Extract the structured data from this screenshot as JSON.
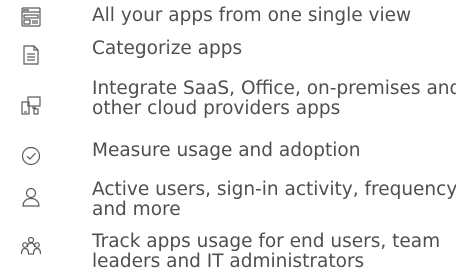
{
  "features": [
    {
      "icon": "app-view-icon",
      "lines": [
        "All your apps from one single view"
      ]
    },
    {
      "icon": "document-icon",
      "lines": [
        "Categorize apps"
      ]
    },
    {
      "icon": "devices-icon",
      "lines": [
        "Integrate SaaS, Office, on-premises and",
        "other cloud providers apps"
      ]
    },
    {
      "icon": "checkmark-circle-icon",
      "lines": [
        "Measure usage and adoption"
      ]
    },
    {
      "icon": "user-icon",
      "lines": [
        "Active users, sign-in activity, frequency,",
        "and more"
      ]
    },
    {
      "icon": "people-group-icon",
      "lines": [
        "Track apps usage for end users, team",
        "leaders and IT administrators"
      ]
    }
  ]
}
